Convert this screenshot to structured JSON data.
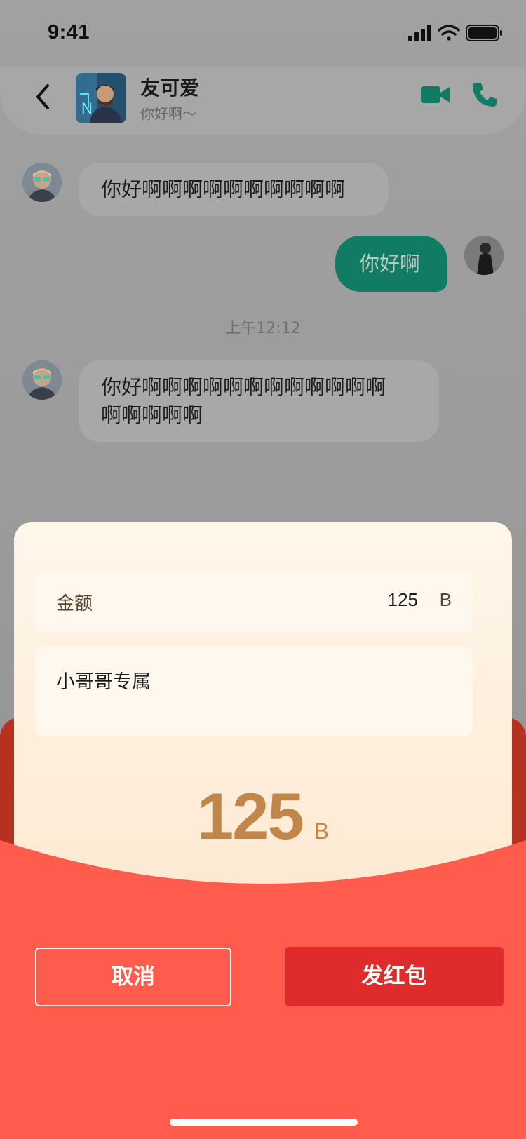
{
  "status_bar": {
    "time": "9:41"
  },
  "header": {
    "contact_name": "友可爱",
    "contact_status": "你好啊～"
  },
  "messages": {
    "incoming_1": "你好啊啊啊啊啊啊啊啊啊啊",
    "outgoing_1": "你好啊",
    "timestamp": "上午12:12",
    "incoming_2_line1": "你好啊啊啊啊啊啊啊啊啊啊啊啊",
    "incoming_2_line2": "啊啊啊啊啊"
  },
  "red_packet": {
    "amount_label": "金额",
    "amount_value": "125",
    "amount_unit": "B",
    "note": "小哥哥专属",
    "display_amount": "125",
    "display_unit": "B",
    "cancel_label": "取消",
    "send_label": "发红包"
  },
  "colors": {
    "accent_green": "#127b63",
    "packet_red": "#ff5c4d",
    "packet_dark_red": "#b73121",
    "send_button": "#df2b2b",
    "amount_gold": "#c18649"
  },
  "icons": [
    "back-icon",
    "video-call-icon",
    "phone-icon",
    "signal-icon",
    "wifi-icon",
    "battery-icon"
  ]
}
